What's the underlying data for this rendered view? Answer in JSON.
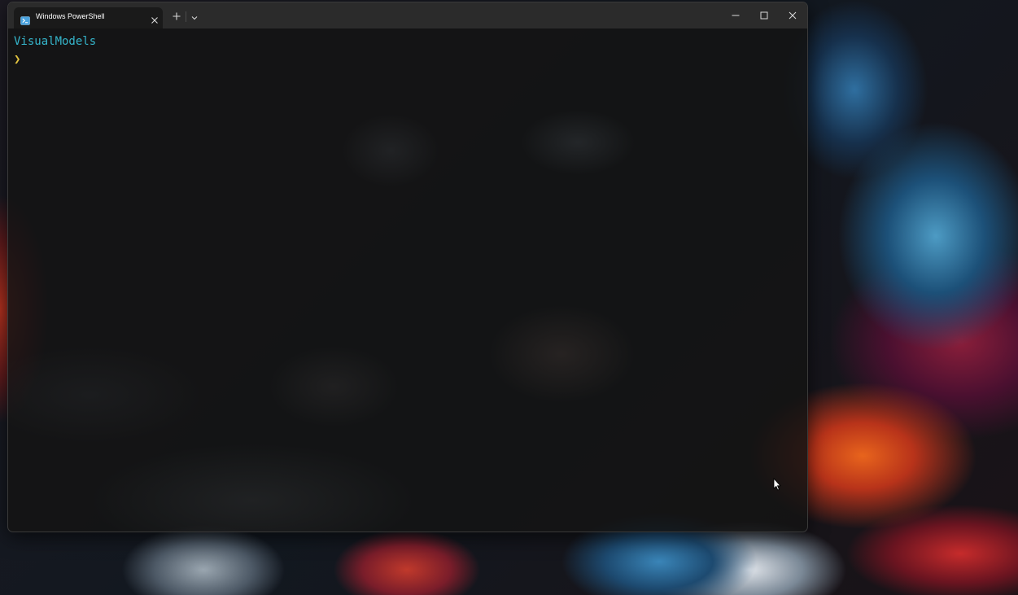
{
  "window": {
    "tab_title": "Windows PowerShell",
    "tab_icon": "powershell-icon",
    "new_tab_icon": "plus-icon",
    "dropdown_icon": "chevron-down-icon",
    "minimize_icon": "minimize-icon",
    "maximize_icon": "maximize-icon",
    "close_icon": "close-icon"
  },
  "terminal": {
    "cwd": "VisualModels",
    "prompt_symbol": "❯"
  },
  "colors": {
    "cwd_text": "#35b6cc",
    "prompt_symbol": "#e3c440",
    "titlebar": "#2b2b2b",
    "active_tab": "#1a1a1a"
  }
}
